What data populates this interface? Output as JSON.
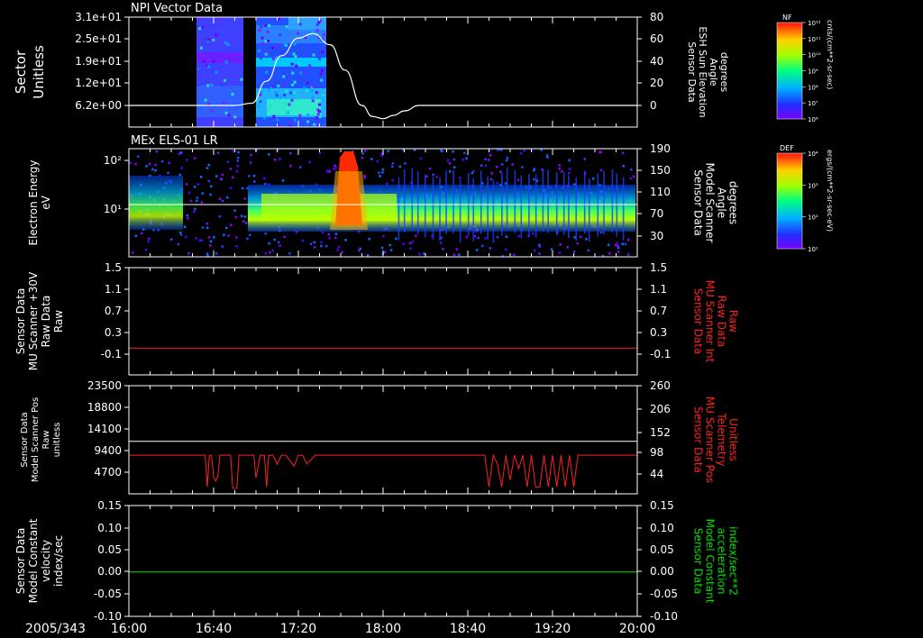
{
  "date_label": "2005/343",
  "time_ticks": [
    "16:00",
    "16:40",
    "17:20",
    "18:00",
    "18:40",
    "19:20",
    "20:00"
  ],
  "colors": {
    "background": "#000000",
    "axis": "#ffffff",
    "trace_white": "#ffffff",
    "trace_red": "#ff2020",
    "trace_green": "#00e000",
    "label_red": "#ff2020",
    "label_green": "#00e000"
  },
  "chart_data": [
    {
      "type": "heatmap",
      "title": "NPI Vector Data",
      "ylabel": [
        "Sector",
        "Unitless"
      ],
      "yticks": [
        "3.1e+01",
        "2.5e+01",
        "1.9e+01",
        "1.2e+01",
        "6.2e+00"
      ],
      "right_label": [
        "Sensor Data",
        "ESH Sun Elevation",
        "Angle",
        "degrees"
      ],
      "right_ticks": [
        "80",
        "60",
        "40",
        "20",
        "0"
      ],
      "right_ylim": [
        -18,
        80
      ],
      "colorbar": {
        "title": "NF",
        "tick_labels": [
          "10¹²",
          "10¹¹",
          "10¹⁰",
          "10⁹",
          "10⁸",
          "10⁷",
          "10⁶"
        ],
        "unit": "cnts/(cm**2-sr-sec)"
      },
      "overlay_line": {
        "name": "ESH Sun Elevation Angle",
        "x": [
          "16:00",
          "16:50",
          "16:58",
          "17:05",
          "17:12",
          "17:20",
          "17:27",
          "17:35",
          "17:42",
          "17:50",
          "17:55",
          "18:00",
          "18:05",
          "18:10",
          "18:17",
          "20:00"
        ],
        "y": [
          0,
          0,
          2,
          22,
          45,
          61,
          65,
          55,
          32,
          0,
          -10,
          -12,
          -9,
          -5,
          0,
          0
        ]
      }
    },
    {
      "type": "heatmap",
      "title": "MEx ELS-01 LR",
      "ylabel": [
        "Electron Energy",
        "eV"
      ],
      "yticks": [
        "10²",
        "10¹"
      ],
      "right_label": [
        "Sensor Data",
        "Model Scanner",
        "Angle",
        "degrees"
      ],
      "right_ticks": [
        "190",
        "150",
        "110",
        "70",
        "30"
      ],
      "right_ylim": [
        0,
        190
      ],
      "colorbar": {
        "title": "DEF",
        "tick_labels": [
          "10⁴",
          "10³",
          "10²",
          "10¹"
        ],
        "unit": "ergs/(cm**2-sr-sec-eV)"
      },
      "overlay_line": {
        "name": "Model Scanner Angle",
        "value": 90
      }
    },
    {
      "type": "line",
      "ylabel": [
        "Sensor Data",
        "MU Scanner +30V",
        "Raw Data",
        "Raw"
      ],
      "yticks": [
        "1.5",
        "1.1",
        "0.7",
        "0.3",
        "-0.1"
      ],
      "ylim": [
        -0.5,
        1.5
      ],
      "right_label": [
        "Sensor Data",
        "MU Scanner Int",
        "Raw Data",
        "Raw"
      ],
      "right_ticks": [
        "1.5",
        "1.1",
        "0.7",
        "0.3",
        "-0.1"
      ],
      "series": [
        {
          "color": "red",
          "x": [
            "16:00",
            "20:00"
          ],
          "y": [
            0.0,
            0.0
          ]
        }
      ]
    },
    {
      "type": "line",
      "ylabel": [
        "Sensor Data",
        "Model Scanner Pos",
        "Raw",
        "unitless"
      ],
      "yticks": [
        "23500",
        "18800",
        "14100",
        "9400",
        "4700"
      ],
      "ylim": [
        0,
        23500
      ],
      "right_label": [
        "Sensor Data",
        "MU Scanner Pos",
        "Telemetry",
        "Unitless"
      ],
      "right_ticks": [
        "260",
        "206",
        "152",
        "98",
        "44"
      ],
      "right_ylim": [
        -10,
        260
      ],
      "series": [
        {
          "color": "white",
          "x": [
            "16:00",
            "20:00"
          ],
          "y": [
            11400,
            11400
          ]
        },
        {
          "color": "red",
          "x": [
            "16:00",
            "16:36",
            "16:37",
            "16:38",
            "16:39",
            "16:40",
            "16:41",
            "16:42",
            "16:43",
            "16:44",
            "16:45",
            "16:46",
            "16:47",
            "16:48",
            "16:49",
            "16:51",
            "16:52",
            "16:53",
            "16:54",
            "16:56",
            "16:58",
            "16:59",
            "17:00",
            "17:02",
            "17:04",
            "17:05",
            "17:06",
            "17:08",
            "17:10",
            "17:12",
            "17:14",
            "17:18",
            "17:20",
            "17:22",
            "17:24",
            "17:28",
            "17:30",
            "18:48",
            "18:50",
            "18:52",
            "18:54",
            "18:56",
            "18:58",
            "19:00",
            "19:02",
            "19:04",
            "19:06",
            "19:08",
            "19:10",
            "19:12",
            "19:14",
            "19:16",
            "19:18",
            "19:20",
            "19:22",
            "19:24",
            "19:26",
            "19:28",
            "19:30",
            "19:32",
            "19:34",
            "19:36",
            "19:38",
            "20:00"
          ],
          "y": [
            8400,
            8400,
            1500,
            8400,
            8400,
            3600,
            2800,
            3900,
            8400,
            8400,
            8400,
            8400,
            8400,
            8400,
            1200,
            1200,
            8400,
            8400,
            8400,
            8400,
            8400,
            8400,
            3500,
            8400,
            8400,
            1500,
            8400,
            8400,
            6500,
            8400,
            8400,
            6000,
            8400,
            8400,
            6500,
            8400,
            8400,
            8400,
            1500,
            8400,
            6500,
            1500,
            8400,
            3000,
            8400,
            5500,
            8400,
            1500,
            8400,
            1500,
            1500,
            8400,
            1500,
            8400,
            1500,
            8400,
            1500,
            8400,
            1500,
            8400,
            8400,
            8400,
            8400,
            8400
          ]
        }
      ]
    },
    {
      "type": "line",
      "ylabel": [
        "Sensor Data",
        "Model Constant",
        "velocity",
        "index/sec"
      ],
      "yticks": [
        "0.15",
        "0.10",
        "0.05",
        "0.00",
        "-0.05",
        "-0.10"
      ],
      "ylim": [
        -0.1,
        0.15
      ],
      "right_label": [
        "Sensor Data",
        "Model Constant",
        "acceleration",
        "index/sec**2"
      ],
      "right_ticks": [
        "0.15",
        "0.10",
        "0.05",
        "0.00",
        "-0.05",
        "-0.10"
      ],
      "series": [
        {
          "color": "green",
          "x": [
            "16:00",
            "20:00"
          ],
          "y": [
            0.0,
            0.0
          ]
        }
      ]
    }
  ]
}
